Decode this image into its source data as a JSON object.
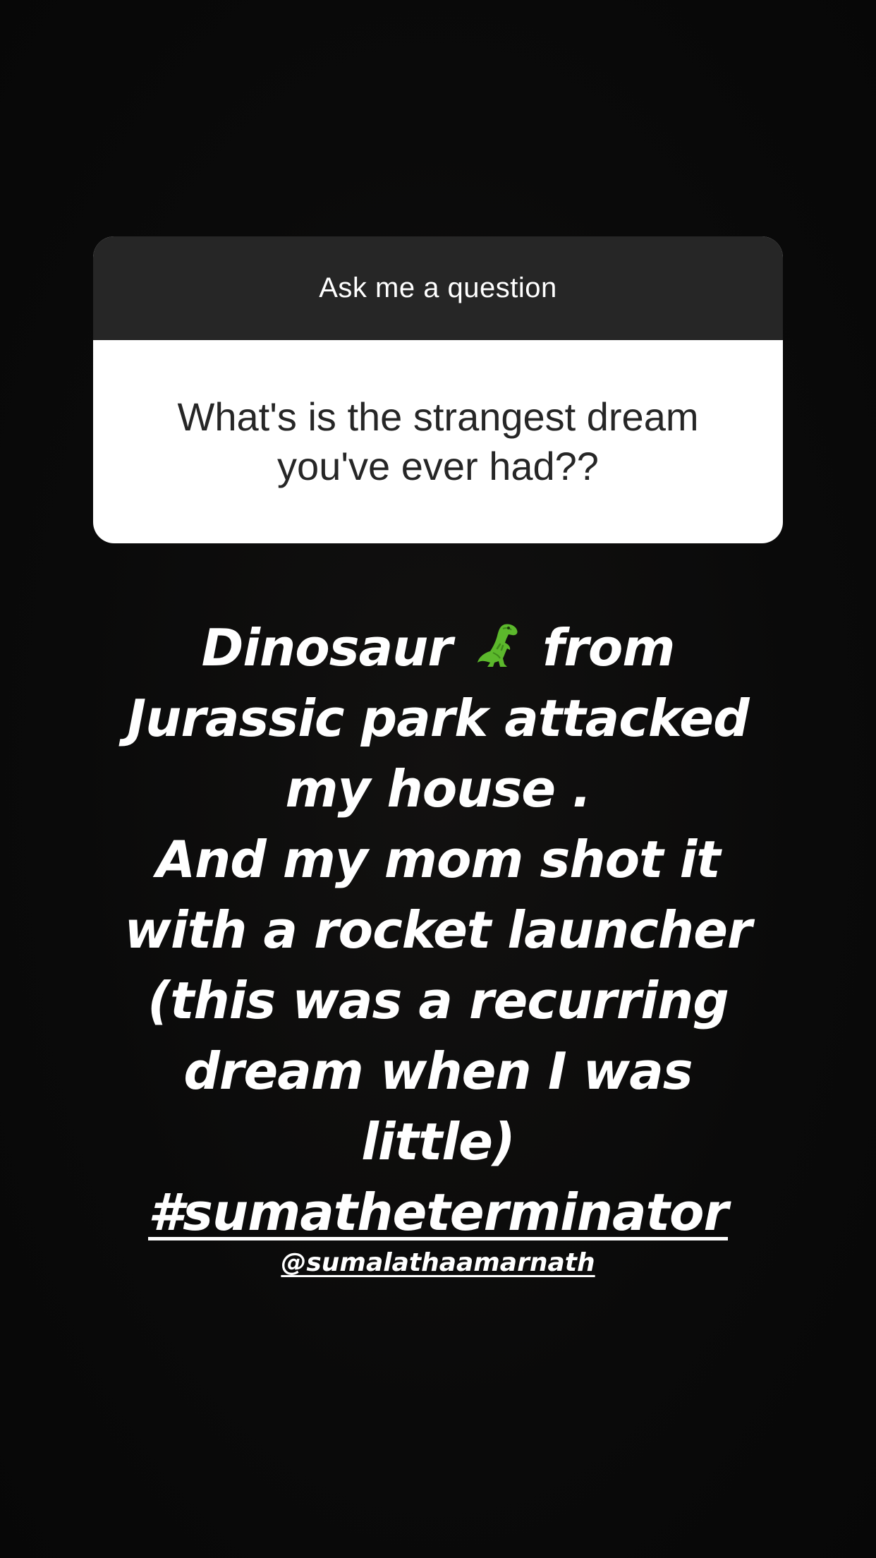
{
  "question_sticker": {
    "header": "Ask me a question",
    "question": "What's is the strangest dream you've ever had??"
  },
  "answer": {
    "line1_before": "Dinosaur",
    "emoji": "t-rex-icon",
    "line1_after": "from",
    "lines": [
      "Jurassic park attacked",
      "my house .",
      "And my mom shot it",
      "with a rocket launcher",
      "(this was a recurring",
      "dream when I was",
      "little)"
    ],
    "hashtag": "#sumatheterminator"
  },
  "mention": "@sumalathaamarnath",
  "colors": {
    "background": "#0b0b0b",
    "sticker_header": "#262626",
    "sticker_body": "#ffffff",
    "text": "#ffffff",
    "dino_green": "#5cb82c"
  }
}
